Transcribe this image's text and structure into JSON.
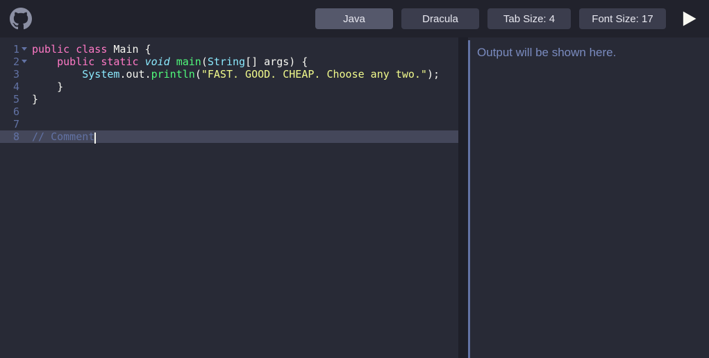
{
  "header": {
    "language_label": "Java",
    "theme_label": "Dracula",
    "tab_size_label": "Tab Size: 4",
    "font_size_label": "Font Size: 17"
  },
  "editor": {
    "line_numbers": [
      "1",
      "2",
      "3",
      "4",
      "5",
      "6",
      "7",
      "8"
    ],
    "fold_lines": [
      1,
      2
    ],
    "active_line_index": 7,
    "code_lines": [
      [
        {
          "t": "public",
          "c": "tk-kw"
        },
        {
          "t": " ",
          "c": ""
        },
        {
          "t": "class",
          "c": "tk-kw"
        },
        {
          "t": " ",
          "c": ""
        },
        {
          "t": "Main",
          "c": "tk-id"
        },
        {
          "t": " ",
          "c": ""
        },
        {
          "t": "{",
          "c": "tk-pn"
        }
      ],
      [
        {
          "t": "    ",
          "c": ""
        },
        {
          "t": "public",
          "c": "tk-kw"
        },
        {
          "t": " ",
          "c": ""
        },
        {
          "t": "static",
          "c": "tk-kw"
        },
        {
          "t": " ",
          "c": ""
        },
        {
          "t": "void",
          "c": "tk-type"
        },
        {
          "t": " ",
          "c": ""
        },
        {
          "t": "main",
          "c": "tk-fn"
        },
        {
          "t": "(",
          "c": "tk-pn"
        },
        {
          "t": "String",
          "c": "tk-cls"
        },
        {
          "t": "[] ",
          "c": "tk-pn"
        },
        {
          "t": "args",
          "c": "tk-id"
        },
        {
          "t": ")",
          "c": "tk-pn"
        },
        {
          "t": " ",
          "c": ""
        },
        {
          "t": "{",
          "c": "tk-pn"
        }
      ],
      [
        {
          "t": "        ",
          "c": ""
        },
        {
          "t": "System",
          "c": "tk-cls"
        },
        {
          "t": ".",
          "c": "tk-pn"
        },
        {
          "t": "out",
          "c": "tk-id"
        },
        {
          "t": ".",
          "c": "tk-pn"
        },
        {
          "t": "println",
          "c": "tk-fn"
        },
        {
          "t": "(",
          "c": "tk-pn"
        },
        {
          "t": "\"FAST. GOOD. CHEAP. Choose any two.\"",
          "c": "tk-str"
        },
        {
          "t": ")",
          "c": "tk-pn"
        },
        {
          "t": ";",
          "c": "tk-pn"
        }
      ],
      [
        {
          "t": "    ",
          "c": ""
        },
        {
          "t": "}",
          "c": "tk-pn"
        }
      ],
      [
        {
          "t": "}",
          "c": "tk-pn"
        }
      ],
      [],
      [],
      [
        {
          "t": "// Comment",
          "c": "tk-cm"
        }
      ]
    ]
  },
  "output": {
    "placeholder": "Output will be shown here."
  },
  "icons": {
    "logo": "github-icon",
    "run": "play-icon"
  }
}
